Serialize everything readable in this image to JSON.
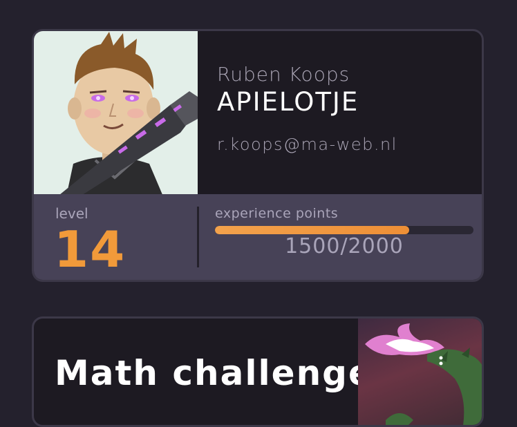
{
  "profile": {
    "name": "Ruben Koops",
    "username": "APIELOTJE",
    "email": "r.koops@ma-web.nl",
    "avatar_icon": "avatar-gamer-boy"
  },
  "stats": {
    "level_label": "level",
    "level_value": "14",
    "xp_label": "experience points",
    "xp_text": "1500/2000",
    "xp_progress": 0.75
  },
  "challenge": {
    "title": "Math challenge",
    "art_icon": "dragon-fire-illustration"
  },
  "colors": {
    "background": "#24212d",
    "card": "#1d1a22",
    "stats_panel": "#474257",
    "accent_orange": "#f19a3a"
  }
}
